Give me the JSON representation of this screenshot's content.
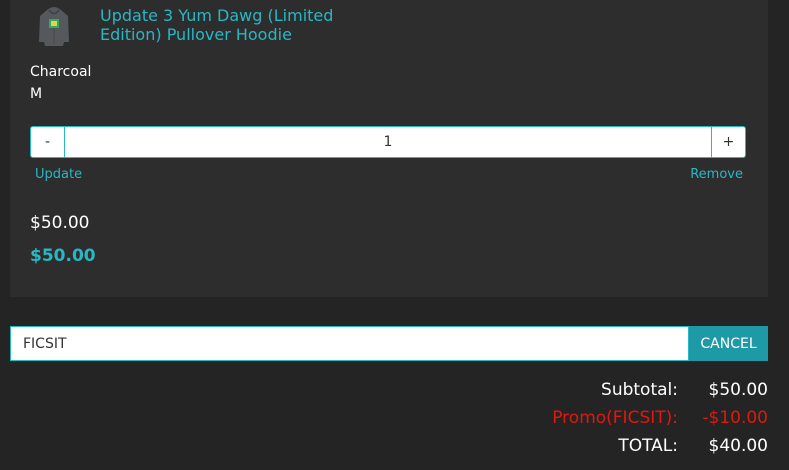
{
  "item": {
    "name": "Update 3 Yum Dawg (Limited Edition) Pullover Hoodie",
    "color": "Charcoal",
    "size": "M",
    "quantity": "1",
    "minus_label": "-",
    "plus_label": "+",
    "update_label": "Update",
    "remove_label": "Remove",
    "unit_price": "$50.00",
    "line_total": "$50.00"
  },
  "promo": {
    "code_value": "FICSIT",
    "cancel_label": "CANCEL"
  },
  "totals": {
    "subtotal_label": "Subtotal:",
    "subtotal_value": "$50.00",
    "promo_label": "Promo(FICSIT):",
    "promo_value": "-$10.00",
    "total_label": "TOTAL:",
    "total_value": "$40.00"
  },
  "colors": {
    "accent": "#28b8c4",
    "promo": "#e0180f",
    "background": "#242424",
    "card": "#2d2d2d"
  }
}
